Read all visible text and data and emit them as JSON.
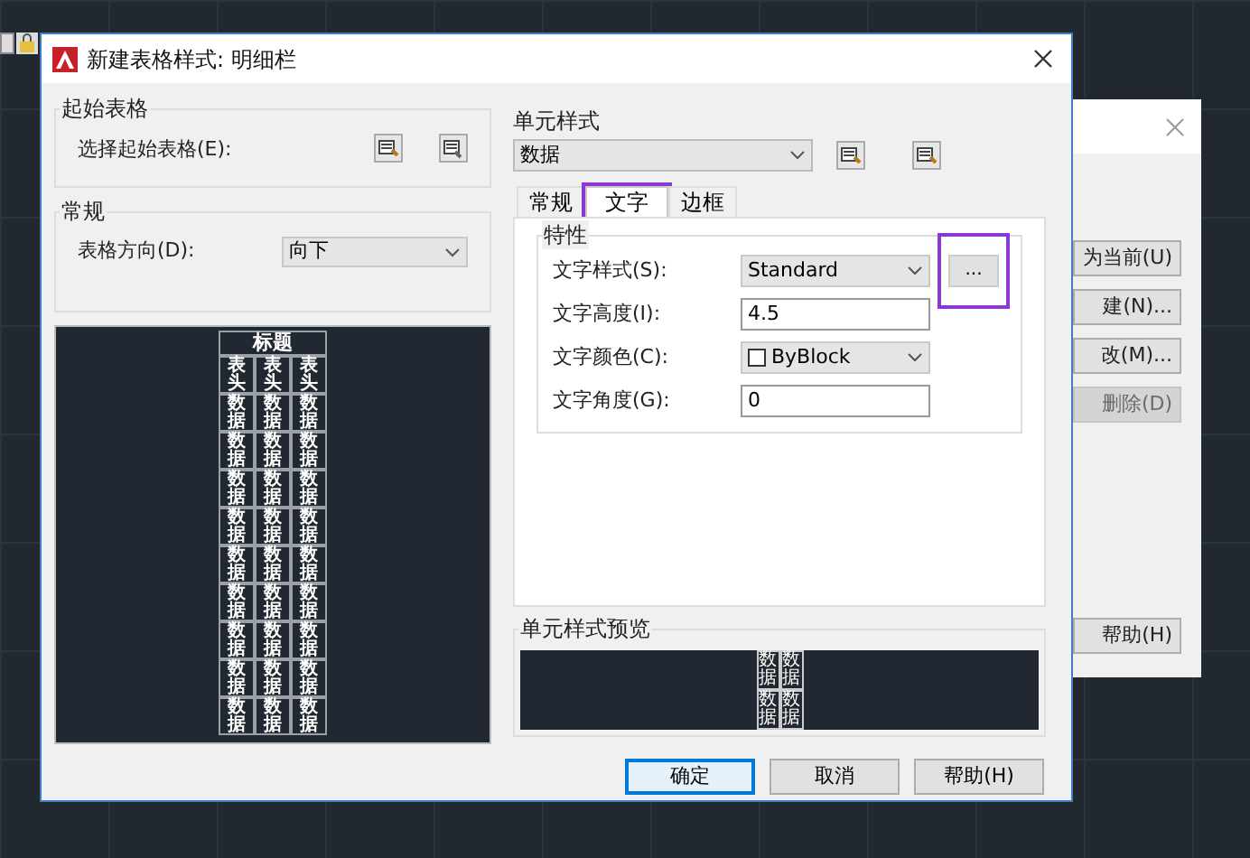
{
  "window": {
    "title": "新建表格样式: 明细栏"
  },
  "starting_table": {
    "title": "起始表格",
    "label": "选择起始表格(E):"
  },
  "general": {
    "title": "常规",
    "direction_label": "表格方向(D):",
    "direction_value": "向下"
  },
  "table_preview": {
    "title": "标题",
    "header": [
      "表头",
      "表头",
      "表头"
    ],
    "rows": [
      [
        "数据",
        "数据",
        "数据"
      ],
      [
        "数据",
        "数据",
        "数据"
      ],
      [
        "数据",
        "数据",
        "数据"
      ],
      [
        "数据",
        "数据",
        "数据"
      ],
      [
        "数据",
        "数据",
        "数据"
      ],
      [
        "数据",
        "数据",
        "数据"
      ],
      [
        "数据",
        "数据",
        "数据"
      ],
      [
        "数据",
        "数据",
        "数据"
      ],
      [
        "数据",
        "数据",
        "数据"
      ]
    ]
  },
  "cell_style": {
    "title": "单元样式",
    "value": "数据"
  },
  "tabs": [
    {
      "label": "常规",
      "selected": false,
      "highlighted": false
    },
    {
      "label": "文字",
      "selected": true,
      "highlighted": true
    },
    {
      "label": "边框",
      "selected": false,
      "highlighted": false
    }
  ],
  "properties": {
    "title": "特性",
    "fields": [
      {
        "kind": "select",
        "label": "文字样式(S):",
        "value": "Standard",
        "browse": "...",
        "highlighted": true
      },
      {
        "kind": "input",
        "label": "文字高度(I):",
        "value": "4.5"
      },
      {
        "kind": "color",
        "label": "文字颜色(C):",
        "value": "ByBlock"
      },
      {
        "kind": "input",
        "label": "文字角度(G):",
        "value": "0"
      }
    ]
  },
  "cell_preview": {
    "title": "单元样式预览",
    "cells": [
      "数据",
      "数据",
      "数据",
      "数据"
    ]
  },
  "buttons": [
    {
      "label": "确定",
      "default": true
    },
    {
      "label": "取消",
      "default": false
    },
    {
      "label": "帮助(H)",
      "default": false
    }
  ],
  "back_dialog": {
    "buttons": [
      {
        "label": "为当前(U)",
        "disabled": false
      },
      {
        "label": "建(N)...",
        "disabled": false
      },
      {
        "label": "改(M)...",
        "disabled": false
      },
      {
        "label": "删除(D)",
        "disabled": true
      },
      {
        "label": "帮助(H)",
        "disabled": false
      }
    ]
  }
}
